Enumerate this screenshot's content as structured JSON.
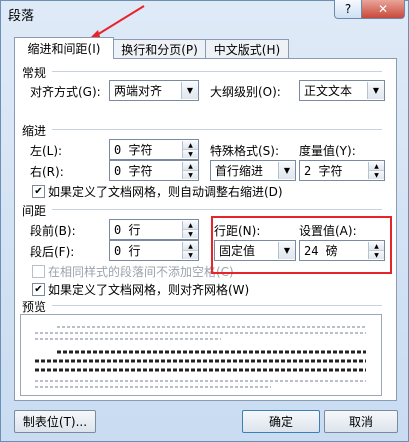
{
  "window": {
    "title": "段落",
    "help_label": "?",
    "close_label": "✕"
  },
  "tabs": [
    {
      "label": "缩进和间距(I)",
      "active": true
    },
    {
      "label": "换行和分页(P)",
      "active": false
    },
    {
      "label": "中文版式(H)",
      "active": false
    }
  ],
  "general": {
    "heading": "常规",
    "alignment_label": "对齐方式(G):",
    "alignment_value": "两端对齐",
    "outline_label": "大纲级别(O):",
    "outline_value": "正文文本"
  },
  "indent": {
    "heading": "缩进",
    "left_label": "左(L):",
    "left_value": "0 字符",
    "right_label": "右(R):",
    "right_value": "0 字符",
    "special_label": "特殊格式(S):",
    "special_value": "首行缩进",
    "measure_label": "度量值(Y):",
    "measure_value": "2 字符",
    "grid_checkbox_label": "如果定义了文档网格，则自动调整右缩进(D)",
    "grid_checked": true
  },
  "spacing": {
    "heading": "间距",
    "before_label": "段前(B):",
    "before_value": "0 行",
    "after_label": "段后(F):",
    "after_value": "0 行",
    "line_spacing_label": "行距(N):",
    "line_spacing_value": "固定值",
    "setting_label": "设置值(A):",
    "setting_value": "24 磅",
    "same_style_label": "在相同样式的段落间不添加空格(C)",
    "same_style_checked": false,
    "snap_grid_label": "如果定义了文档网格，则对齐网格(W)",
    "snap_grid_checked": true
  },
  "preview": {
    "heading": "预览"
  },
  "buttons": {
    "tabs_label": "制表位(T)...",
    "ok_label": "确定",
    "cancel_label": "取消"
  },
  "colors": {
    "highlight_box": "#e8242b",
    "arrow": "#e8242b"
  }
}
